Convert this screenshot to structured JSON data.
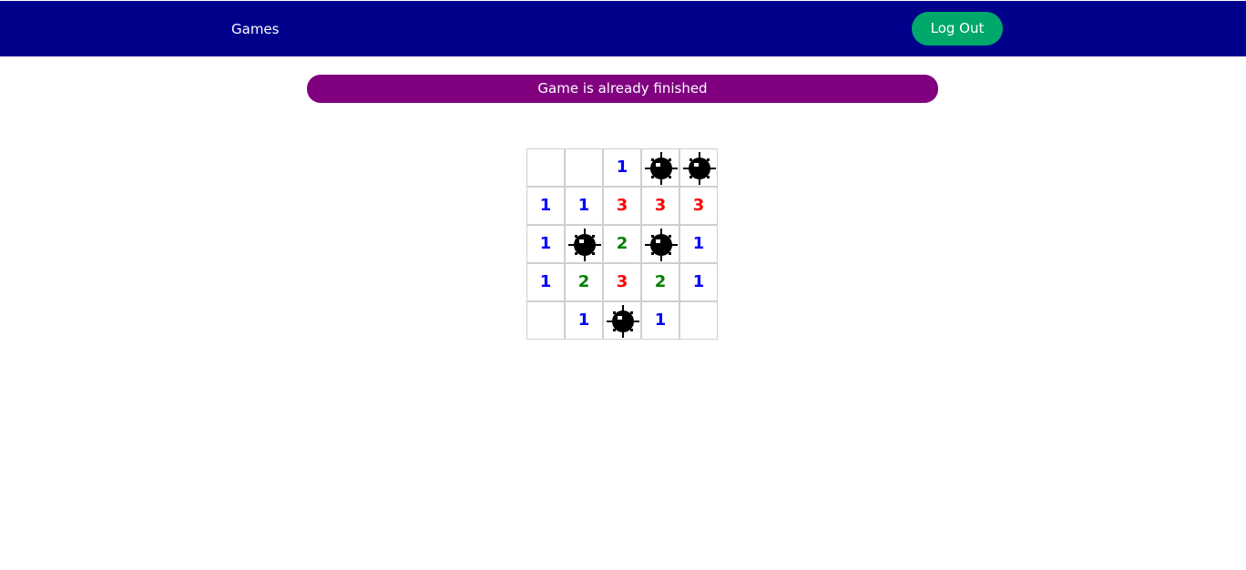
{
  "nav": {
    "games_label": "Games",
    "logout_label": "Log Out"
  },
  "status": {
    "message": "Game is already finished"
  },
  "colors": {
    "nav_bg": "#00008b",
    "logout_bg": "#00a86b",
    "status_bg": "#800080",
    "num_1": "#0000ff",
    "num_2": "#008000",
    "num_3": "#ff0000"
  },
  "board": {
    "rows": 5,
    "cols": 5,
    "cells": [
      [
        "",
        "",
        "1",
        "mine",
        "mine"
      ],
      [
        "1",
        "1",
        "3",
        "3",
        "3"
      ],
      [
        "1",
        "mine",
        "2",
        "mine",
        "1"
      ],
      [
        "1",
        "2",
        "3",
        "2",
        "1"
      ],
      [
        "",
        "1",
        "mine",
        "1",
        ""
      ]
    ]
  }
}
